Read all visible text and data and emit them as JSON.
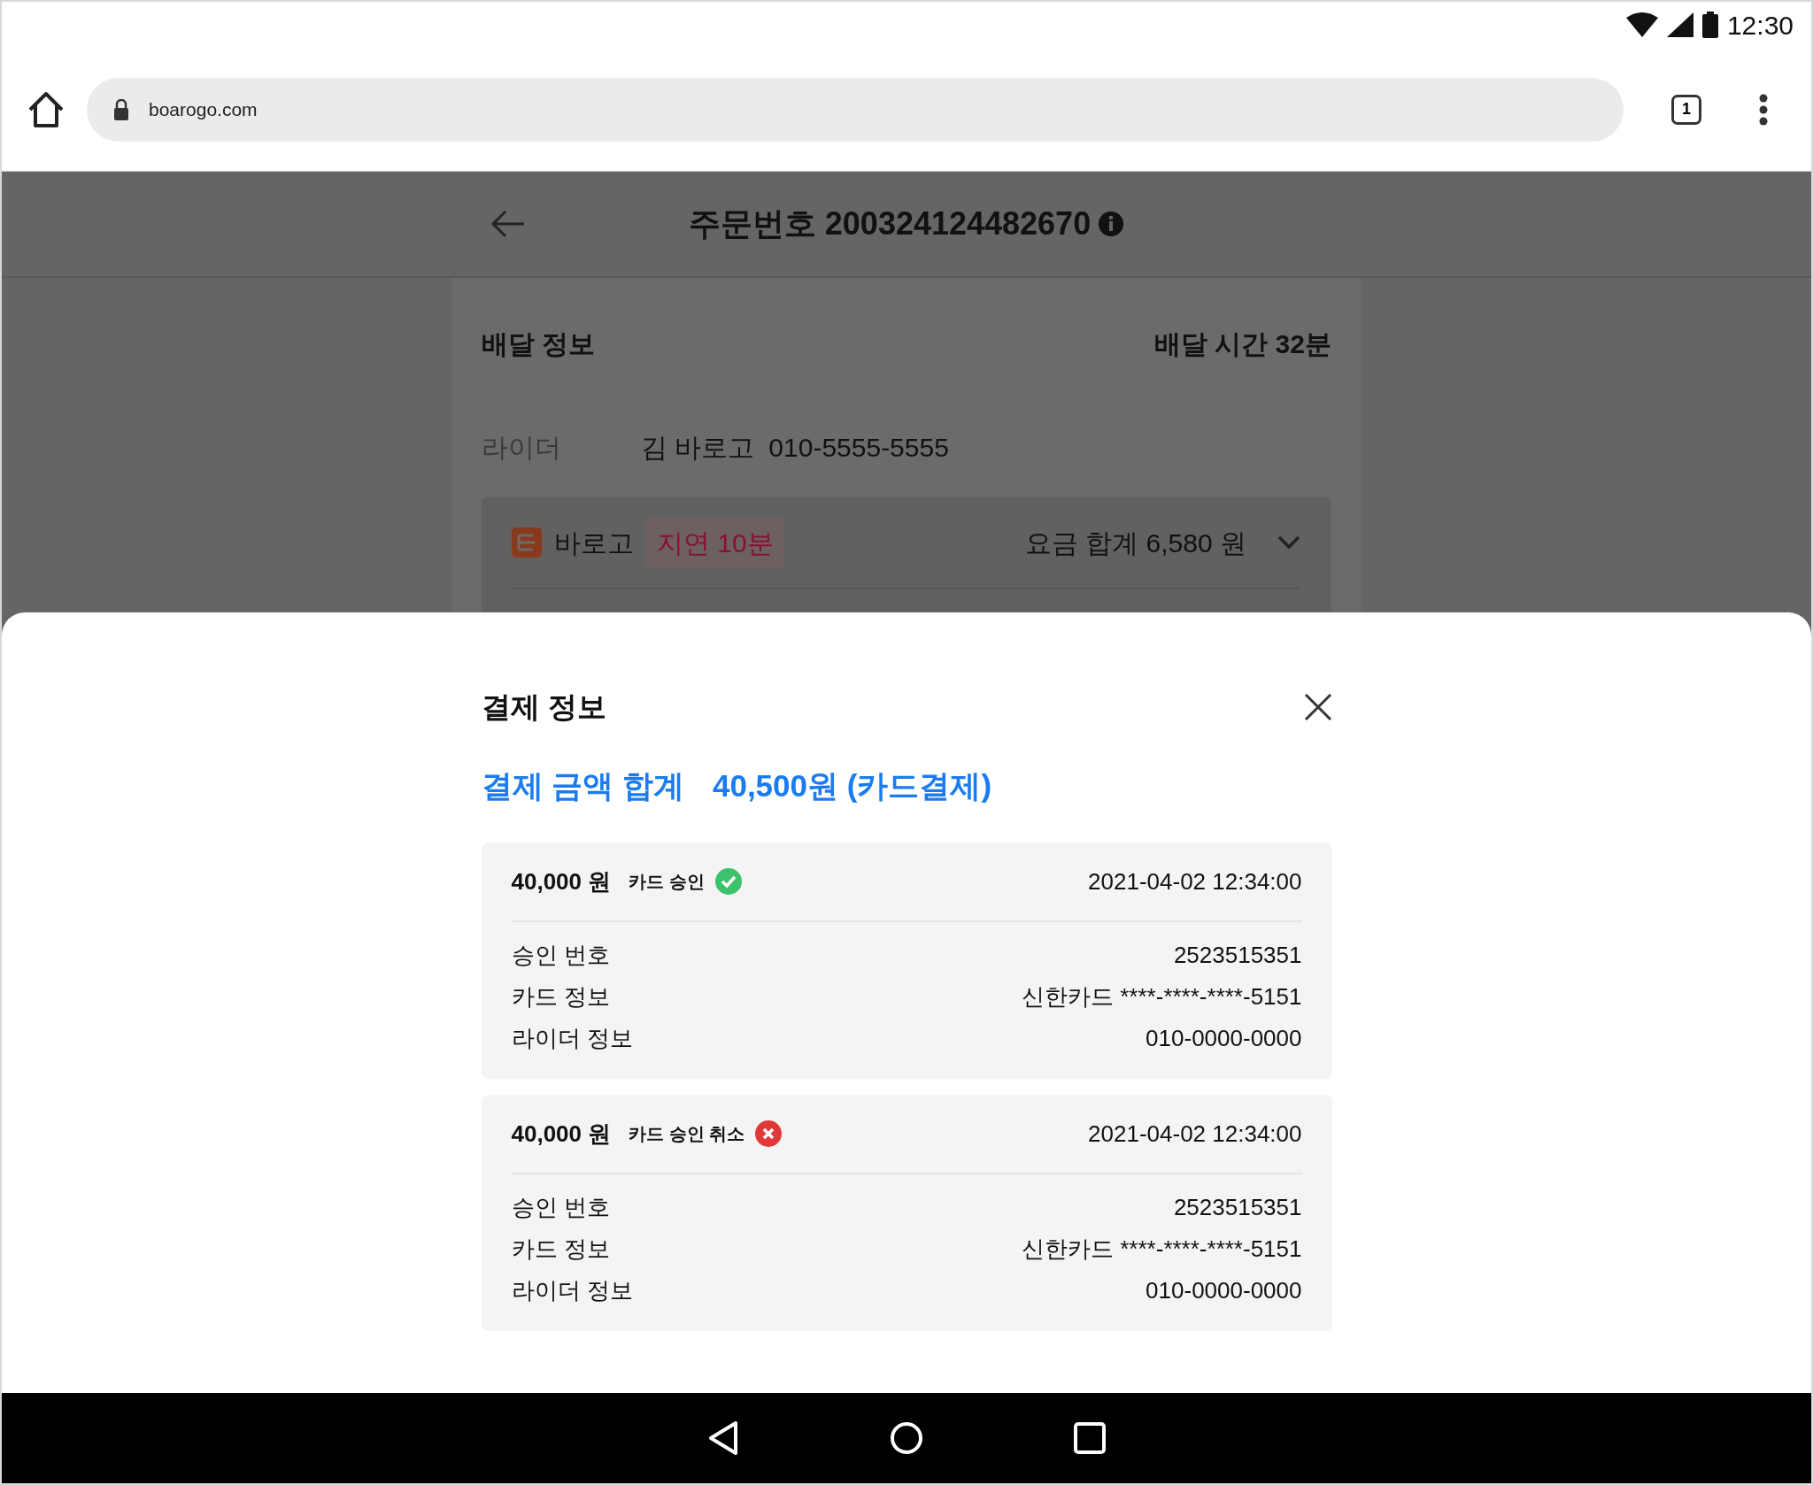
{
  "status_bar": {
    "time": "12:30"
  },
  "browser": {
    "url": "boarogo.com",
    "tab_count": "1"
  },
  "page": {
    "title": "주문번호 200324124482670",
    "section_title": "배달 정보",
    "delivery_time": "배달 시간 32분",
    "rider_label": "라이더",
    "rider_name": "김 바로고",
    "rider_phone": "010-5555-5555",
    "provider": {
      "name": "바로고",
      "delay": "지연 10분",
      "fee": "요금 합계 6,580 원",
      "expanded": false
    }
  },
  "modal": {
    "title": "결제 정보",
    "total_label": "결제 금액 합계",
    "total_value": "40,500원 (카드결제)",
    "payments": [
      {
        "amount": "40,000 원",
        "status_label": "카드 승인",
        "kind": "approved",
        "datetime": "2021-04-02 12:34:00",
        "details": [
          {
            "label": "승인 번호",
            "value": "2523515351"
          },
          {
            "label": "카드 정보",
            "value": "신한카드 ****-****-****-5151"
          },
          {
            "label": "라이더 정보",
            "value": "010-0000-0000"
          }
        ]
      },
      {
        "amount": "40,000 원",
        "status_label": "카드 승인 취소",
        "kind": "cancelled",
        "datetime": "2021-04-02 12:34:00",
        "details": [
          {
            "label": "승인 번호",
            "value": "2523515351"
          },
          {
            "label": "카드 정보",
            "value": "신한카드 ****-****-****-5151"
          },
          {
            "label": "라이더 정보",
            "value": "010-0000-0000"
          }
        ]
      }
    ]
  }
}
